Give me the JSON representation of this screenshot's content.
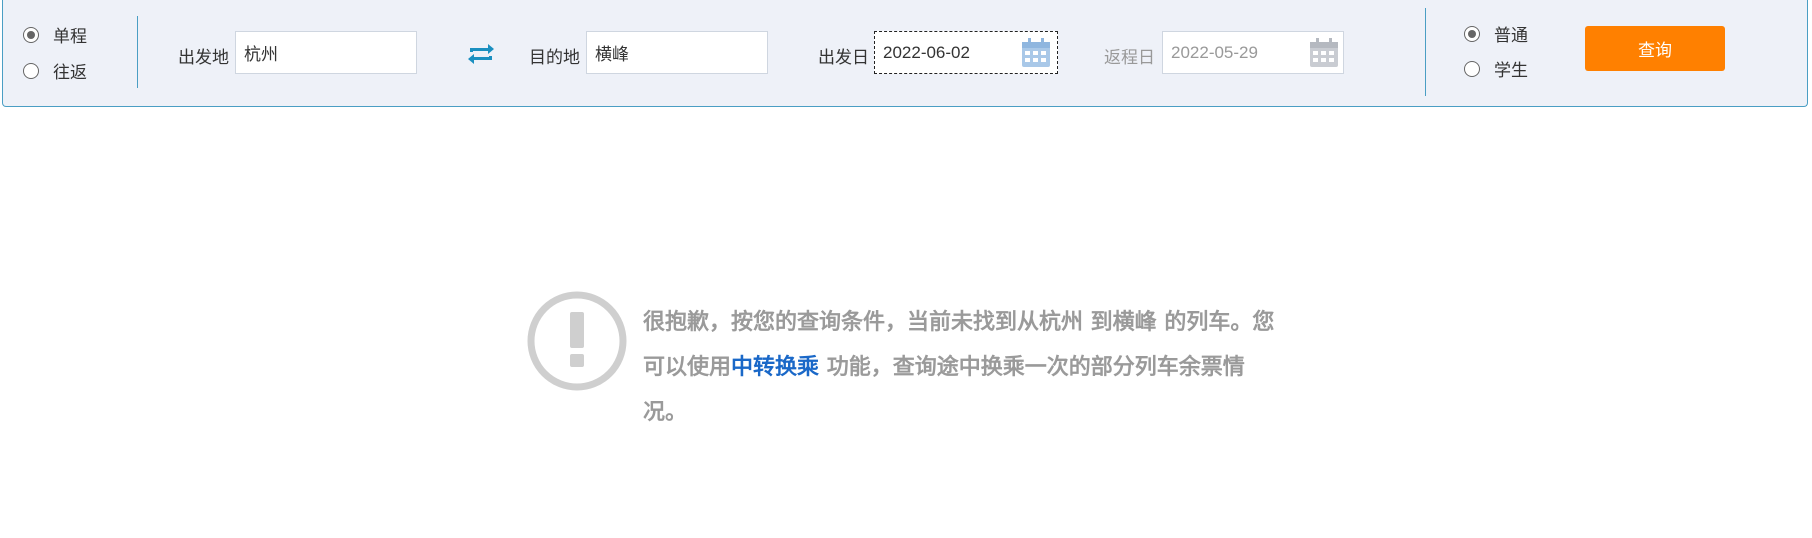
{
  "trip_type": {
    "options": [
      {
        "label": "单程",
        "selected": true
      },
      {
        "label": "往返",
        "selected": false
      }
    ]
  },
  "from": {
    "label": "出发地",
    "value": "杭州"
  },
  "to": {
    "label": "目的地",
    "value": "横峰"
  },
  "depart_date": {
    "label": "出发日",
    "value": "2022-06-02"
  },
  "return_date": {
    "label": "返程日",
    "value": "2022-05-29",
    "disabled": true
  },
  "passenger_type": {
    "options": [
      {
        "label": "普通",
        "selected": true
      },
      {
        "label": "学生",
        "selected": false
      }
    ]
  },
  "query_button": {
    "label": "查询"
  },
  "notice": {
    "text_before": "很抱歉，按您的查询条件，当前未找到从杭州 到横峰 的列车。您可以使用",
    "link_text": "中转换乘",
    "text_after": " 功能，查询途中换乘一次的部分列车余票情况。"
  },
  "colors": {
    "accent": "#ff8000",
    "border": "#4a9ec4",
    "link": "#1a68c8",
    "bar_bg": "#eef1f8"
  },
  "icons": [
    "swap-icon",
    "calendar-icon",
    "warning-icon"
  ]
}
